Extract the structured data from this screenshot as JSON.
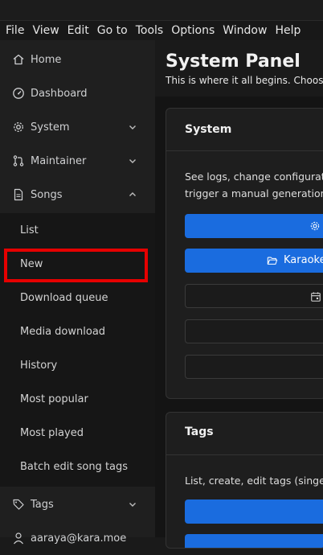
{
  "menubar": [
    "File",
    "View",
    "Edit",
    "Go to",
    "Tools",
    "Options",
    "Window",
    "Help"
  ],
  "sidebar": {
    "items": [
      {
        "label": "Home",
        "icon": "home-icon"
      },
      {
        "label": "Dashboard",
        "icon": "gauge-icon"
      },
      {
        "label": "System",
        "icon": "gear-icon",
        "expanded": false
      },
      {
        "label": "Maintainer",
        "icon": "merge-icon",
        "expanded": false
      },
      {
        "label": "Songs",
        "icon": "file-icon",
        "expanded": true
      }
    ],
    "songs_sub": [
      "List",
      "New",
      "Download queue",
      "Media download",
      "History",
      "Most popular",
      "Most played",
      "Batch edit song tags"
    ],
    "tags": {
      "label": "Tags",
      "icon": "tag-icon"
    },
    "user": {
      "label": "aaraya@kara.moe"
    }
  },
  "main": {
    "title": "System Panel",
    "subtitle": "This is where it all begins. Choose",
    "system_card": {
      "title": "System",
      "text_lines": [
        "See logs, change configuration",
        "trigger a manual generation a"
      ],
      "karaoke_button": "Karaoke"
    },
    "tags_card": {
      "title": "Tags",
      "text": "List, create, edit tags (singers"
    }
  }
}
